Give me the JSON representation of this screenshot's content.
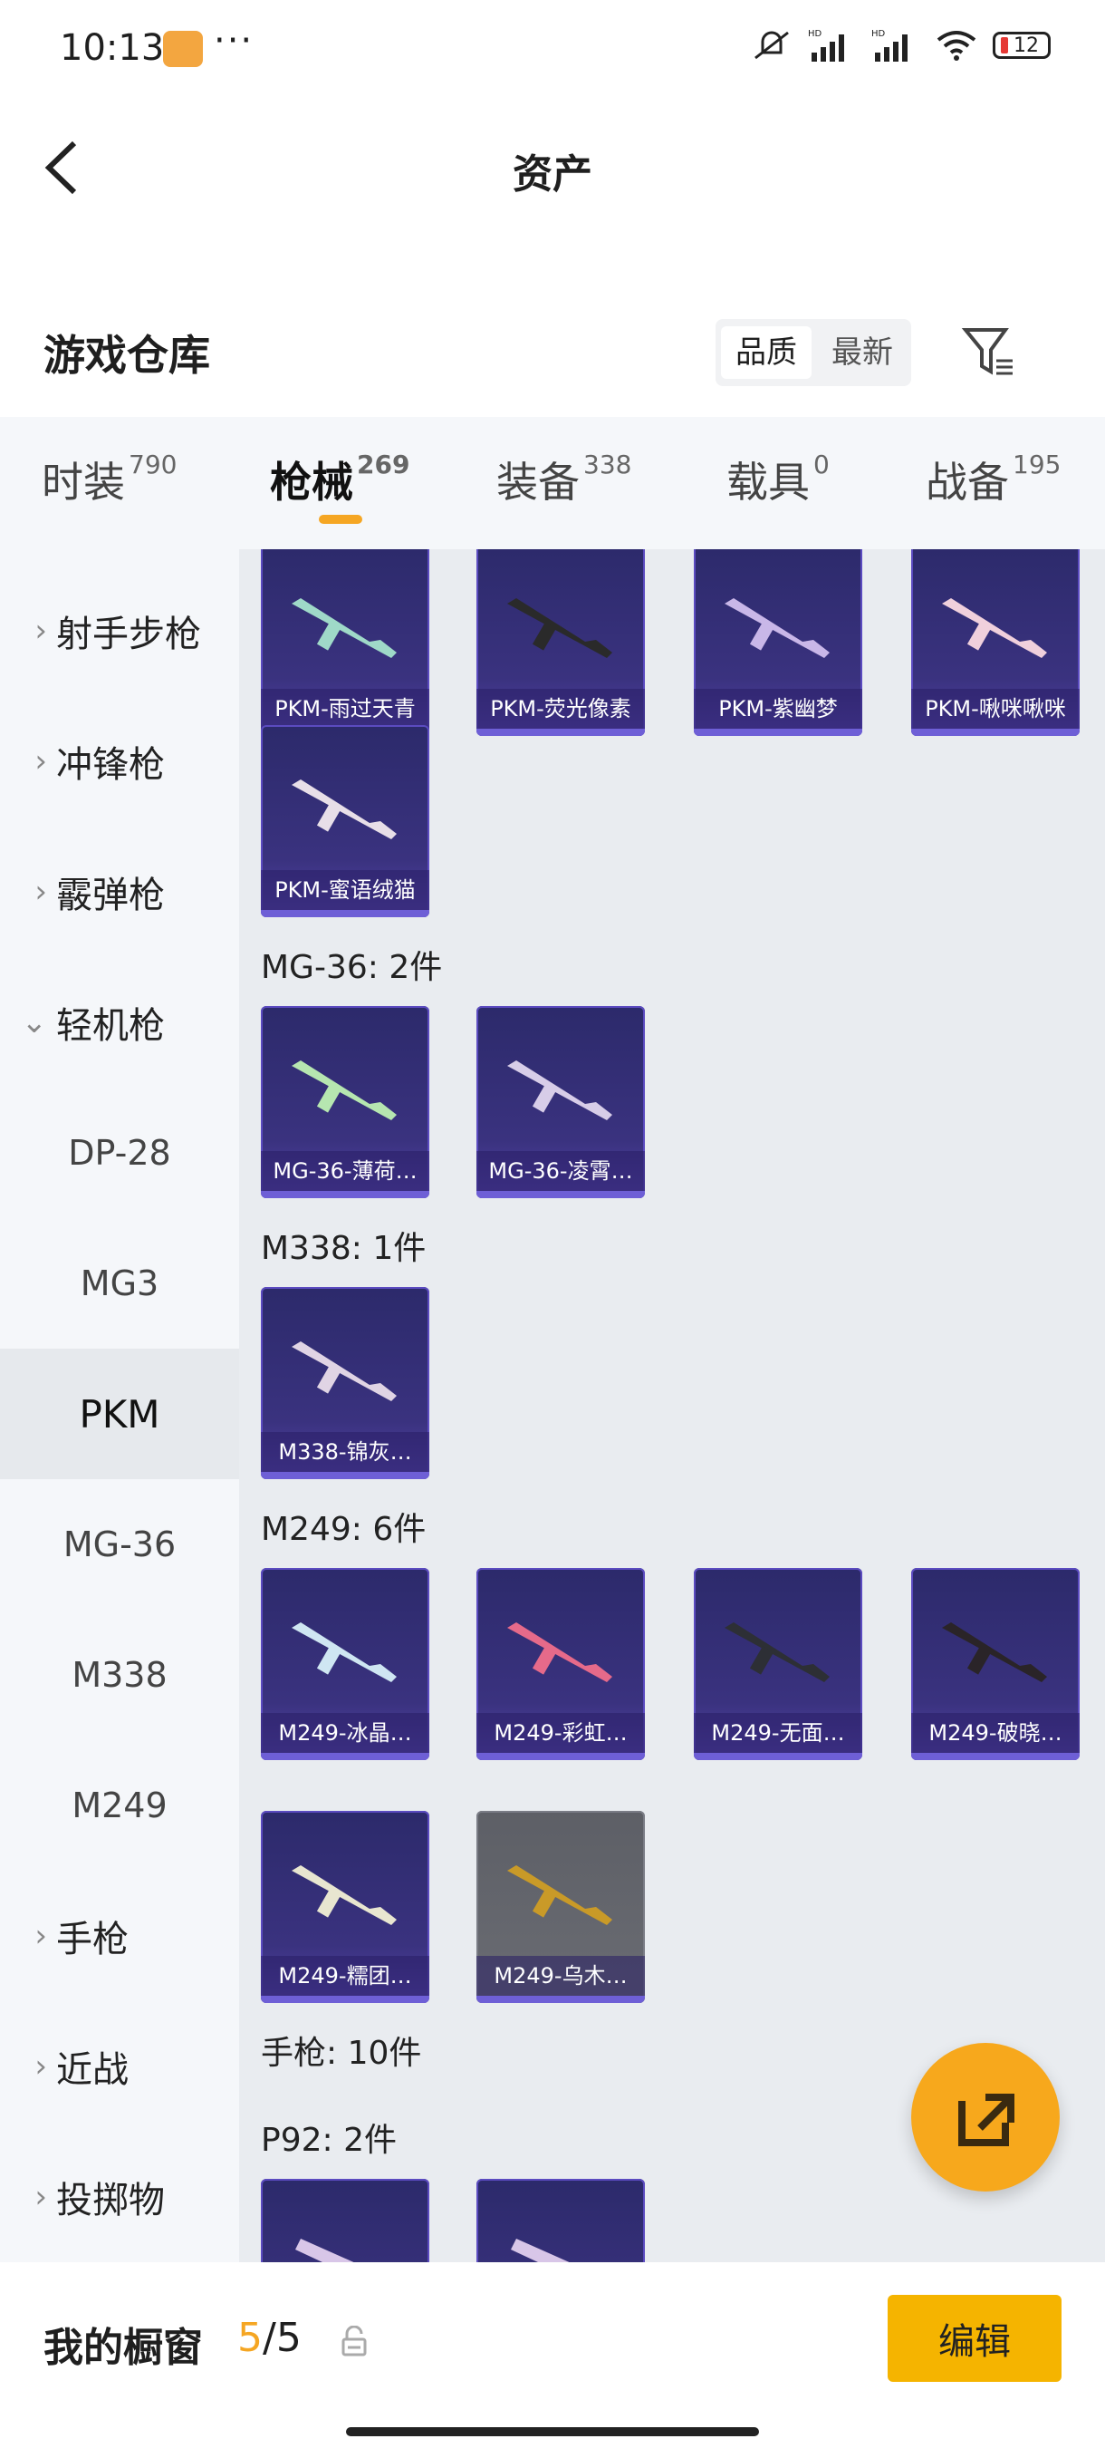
{
  "status_bar": {
    "time": "10:13",
    "dots": "···",
    "battery": "12"
  },
  "header": {
    "title": "资产"
  },
  "section": {
    "title": "游戏仓库",
    "sort_quality": "品质",
    "sort_newest": "最新"
  },
  "tabs": [
    {
      "label": "时装",
      "count": "790"
    },
    {
      "label": "枪械",
      "count": "269"
    },
    {
      "label": "装备",
      "count": "338"
    },
    {
      "label": "载具",
      "count": "0"
    },
    {
      "label": "战备",
      "count": "195"
    }
  ],
  "sidebar": [
    {
      "label": "射手步枪",
      "chev": "›"
    },
    {
      "label": "冲锋枪",
      "chev": "›"
    },
    {
      "label": "霰弹枪",
      "chev": "›"
    },
    {
      "label": "轻机枪",
      "chev": "⌄"
    },
    {
      "label": "DP-28"
    },
    {
      "label": "MG3"
    },
    {
      "label": "PKM"
    },
    {
      "label": "MG-36"
    },
    {
      "label": "M338"
    },
    {
      "label": "M249"
    },
    {
      "label": "手枪",
      "chev": "›"
    },
    {
      "label": "近战",
      "chev": "›"
    },
    {
      "label": "投掷物",
      "chev": "›"
    }
  ],
  "cards": [
    {
      "label": "PKM-雨过天青",
      "gun": "#9fd9c8"
    },
    {
      "label": "PKM-荧光像素",
      "gun": "#2a2a2a"
    },
    {
      "label": "PKM-紫幽梦",
      "gun": "#c9b7e8"
    },
    {
      "label": "PKM-啾咪啾咪",
      "gun": "#f0d0dc"
    },
    {
      "label": "PKM-蜜语绒猫",
      "gun": "#e8dfe8"
    },
    {
      "label": "MG-36-薄荷…",
      "gun": "#b6e6b0"
    },
    {
      "label": "MG-36-凌霄…",
      "gun": "#d7cde8"
    },
    {
      "label": "M338-锦灰…",
      "gun": "#e0d4e4"
    },
    {
      "label": "M249-冰晶…",
      "gun": "#cfe6f2"
    },
    {
      "label": "M249-彩虹…",
      "gun": "#e66a8a"
    },
    {
      "label": "M249-无面…",
      "gun": "#2d2f35"
    },
    {
      "label": "M249-破晓…",
      "gun": "#2a2428"
    },
    {
      "label": "M249-糯团…",
      "gun": "#e8e6d0"
    },
    {
      "label": "M249-乌木…",
      "gun": "#c99a28"
    },
    {
      "label": "",
      "gun": "#d8c6e8"
    },
    {
      "label": "",
      "gun": "#d8c6e8"
    }
  ],
  "groups": {
    "mg36": "MG-36: 2件",
    "m338": "M338: 1件",
    "m249": "M249: 6件",
    "pistol": "手枪: 10件",
    "p92": "P92: 2件"
  },
  "bottom": {
    "label": "我的橱窗",
    "current": "5",
    "total": "/5",
    "edit": "编辑"
  },
  "colors": {
    "accent": "#f5a623",
    "card": "#3a327f"
  }
}
